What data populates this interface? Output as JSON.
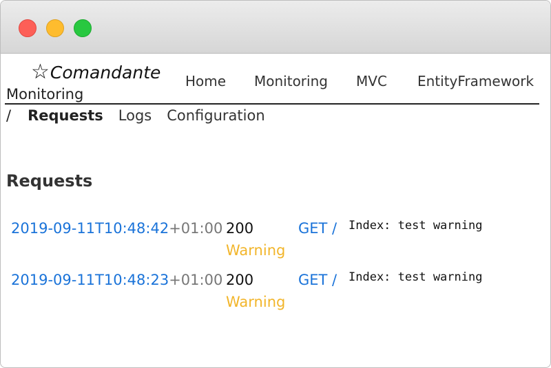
{
  "brand": {
    "star": "☆",
    "name": "Comandante"
  },
  "nav": {
    "items": [
      "Home",
      "Monitoring",
      "MVC",
      "EntityFramework"
    ]
  },
  "breadcrumb": {
    "root": "Monitoring",
    "separator": "/"
  },
  "subnav": {
    "items": [
      "Requests",
      "Logs",
      "Configuration"
    ],
    "active": "Requests"
  },
  "section": {
    "title": "Requests"
  },
  "requests": [
    {
      "time": "2019-09-11T10:48:42",
      "tz": "+01:00",
      "status": "200",
      "level": "Warning",
      "method": "GET /",
      "message": "Index: test warning"
    },
    {
      "time": "2019-09-11T10:48:23",
      "tz": "+01:00",
      "status": "200",
      "level": "Warning",
      "method": "GET /",
      "message": "Index: test warning"
    }
  ],
  "colors": {
    "link": "#1a73d9",
    "warning": "#f2b52a",
    "close": "#fd5f57",
    "minimize": "#febc2e",
    "maximize": "#28c840"
  }
}
